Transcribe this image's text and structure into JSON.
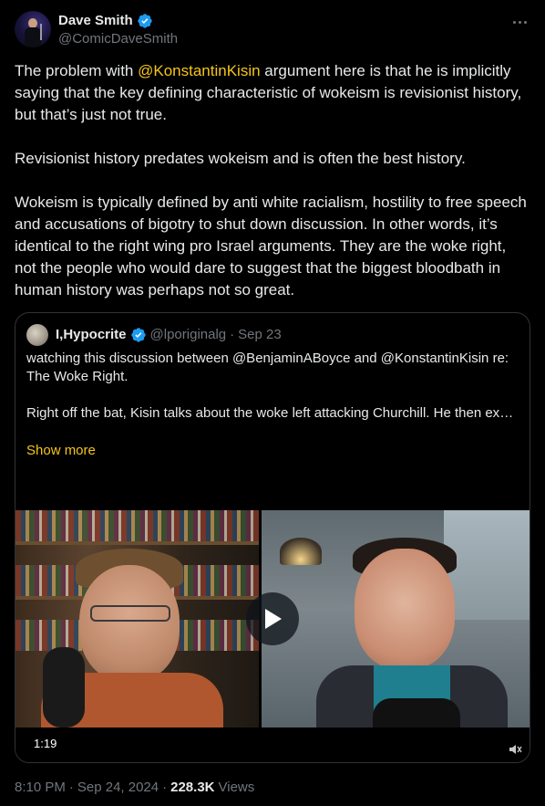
{
  "author": {
    "display_name": "Dave Smith",
    "handle": "@ComicDaveSmith",
    "verified_icon": "verified-badge-icon",
    "badge_color": "#1d9bf0"
  },
  "post": {
    "mention": "@KonstantinKisin",
    "p1_before": "The problem with ",
    "p1_after": " argument here is that he is implicitly saying that the key defining characteristic of wokeism is revisionist history, but that’s just not true.",
    "p2": "Revisionist history predates wokeism and is often the best history.",
    "p3": "Wokeism is typically defined by anti white racialism, hostility to free speech and accusations of bigotry to shut down discussion. In other words, it’s identical to the right wing pro Israel arguments. They are the woke right, not the people who would dare to suggest that the biggest bloodbath in human history was perhaps not so great.",
    "mention_color": "#f5c518"
  },
  "quote": {
    "display_name": "I,Hypocrite",
    "handle": "@lporiginalg",
    "separator": "·",
    "date": "Sep 23",
    "line1": "watching this discussion between @BenjaminABoyce and @KonstantinKisin re: The Woke Right.",
    "line2": "Right off the bat, Kisin talks about the woke left attacking Churchill. He then explains how this is bad because our society has mythologies that are sacred...",
    "show_more": "Show more",
    "video_duration": "1:19"
  },
  "meta": {
    "time": "8:10 PM",
    "sep1": "·",
    "date": "Sep 24, 2024",
    "sep2": "·",
    "views_count": "228.3K",
    "views_label": "Views"
  }
}
